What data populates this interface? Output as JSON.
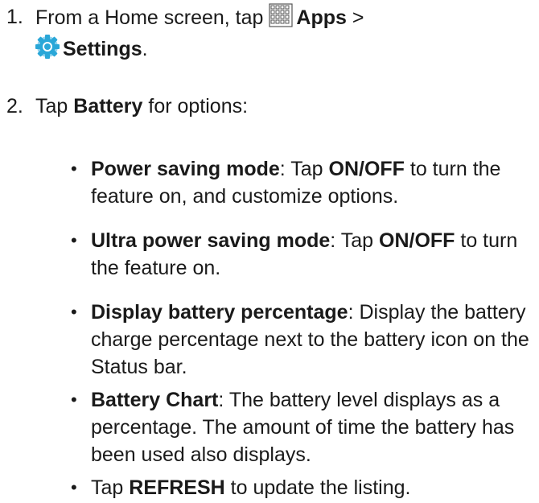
{
  "steps": [
    {
      "number": "1.",
      "before": "From a Home screen, tap ",
      "apps_icon": "apps-grid-icon",
      "apps_label": "Apps",
      "separator": " >",
      "settings_icon": "settings-gear-icon",
      "settings_label": "Settings",
      "after": "."
    },
    {
      "number": "2.",
      "before": "Tap ",
      "bold": "Battery",
      "after": " for options:"
    }
  ],
  "bullets": [
    {
      "symbol": "•",
      "term": "Power saving mode",
      "text1": ": Tap ",
      "bold2": "ON/OFF",
      "text2": " to turn the feature on, and customize options."
    },
    {
      "symbol": "•",
      "term": "Ultra power saving mode",
      "text1": ": Tap ",
      "bold2": "ON/OFF",
      "text2": " to turn the feature on."
    },
    {
      "symbol": "•",
      "term": "Display battery percentage",
      "text1": ": Display the battery charge percentage next to the battery icon on the Status bar."
    },
    {
      "symbol": "•",
      "term": "Battery Chart",
      "text1": ": The battery level displays as a percentage. The amount of time the battery has been used also displays."
    },
    {
      "symbol": "•",
      "pre": "Tap ",
      "term": "REFRESH",
      "text1": " to update the listing."
    }
  ],
  "colors": {
    "text": "#1a1a1a",
    "settings_icon": "#2aa7d8"
  }
}
